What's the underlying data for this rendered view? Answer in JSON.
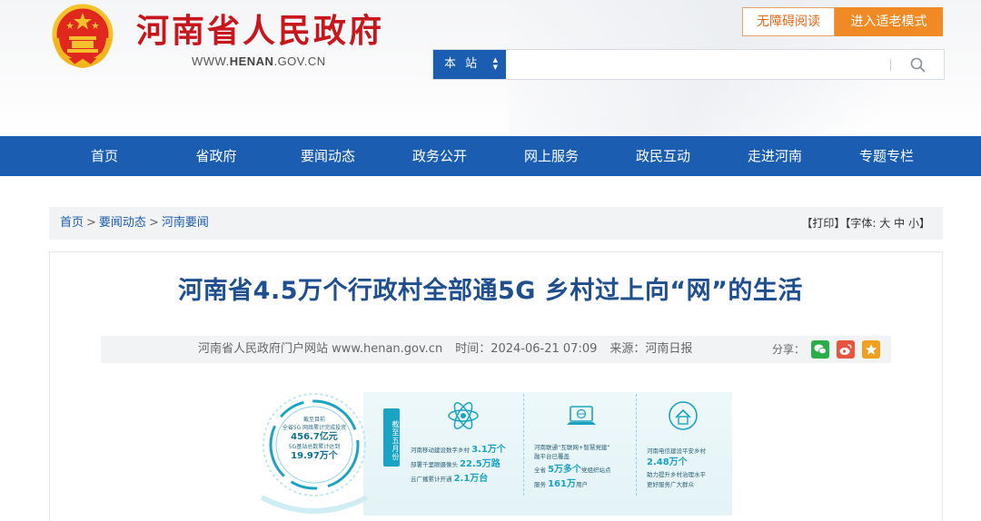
{
  "header": {
    "title": "河南省人民政府",
    "domain_prefix": "WWW.",
    "domain_main": "HENAN",
    "domain_suffix": ".GOV.CN",
    "accessibility_button": "无障碍阅读",
    "elder_mode_button": "进入适老模式",
    "emblem_icon": "national-emblem-icon"
  },
  "search": {
    "scope_label": "本 站",
    "placeholder": "",
    "value": "",
    "icon": "search-icon"
  },
  "nav": {
    "items": [
      "首页",
      "省政府",
      "要闻动态",
      "政务公开",
      "网上服务",
      "政民互动",
      "走进河南",
      "专题专栏"
    ]
  },
  "breadcrumb": {
    "items": [
      "首页",
      "要闻动态",
      "河南要闻"
    ],
    "separator": ">"
  },
  "tools": {
    "print": "【打印】",
    "font_label": "【字体:",
    "font_large": "大",
    "font_medium": "中",
    "font_small": "小",
    "font_close": "】"
  },
  "article": {
    "title": "河南省4.5万个行政村全部通5G 乡村过上向“网”的生活",
    "source_site": "河南省人民政府门户网站 www.henan.gov.cn",
    "time_label": "时间：",
    "time_value": "2024-06-21 07:09",
    "origin_label": "来源：",
    "origin_value": "河南日报",
    "share_label": "分享：",
    "share_icons": [
      "wechat-icon",
      "weibo-icon",
      "favorite-icon"
    ]
  },
  "colors": {
    "brand_red": "#c8161d",
    "nav_blue": "#1b5db0",
    "title_blue": "#1f4f8f",
    "accent_orange": "#f08a24",
    "info_teal": "#1aa3c2"
  },
  "infographic": {
    "ring_line1": "截至目前",
    "ring_line2": "全省5G 网络累计完成投资",
    "ring_value1": "456.7亿元",
    "ring_line3": "5G基站总数累计达到",
    "ring_value2": "19.97万个",
    "tag": "截至五月份",
    "col1": {
      "l1_pre": "河南移动建设数字乡村",
      "l1_val": "3.1万个",
      "l2_pre": "部署千里眼摄像头",
      "l2_val": "22.5万路",
      "l3_pre": "云广播累计开通",
      "l3_val": "2.1万台"
    },
    "col2": {
      "l1": "河南联通“互联网+智慧党建”",
      "l2": "融平台已覆盖",
      "l3_pre": "全省",
      "l3_val": "5万多个",
      "l3_post": "党组织站点",
      "l4_pre": "服务",
      "l4_val": "161万",
      "l4_post": "用户"
    },
    "col3": {
      "l1": "河南电信建设平安乡村",
      "l2_val": "2.48万个",
      "l3": "助力提升乡村治理水平",
      "l4": "更好服务广大群众"
    }
  }
}
